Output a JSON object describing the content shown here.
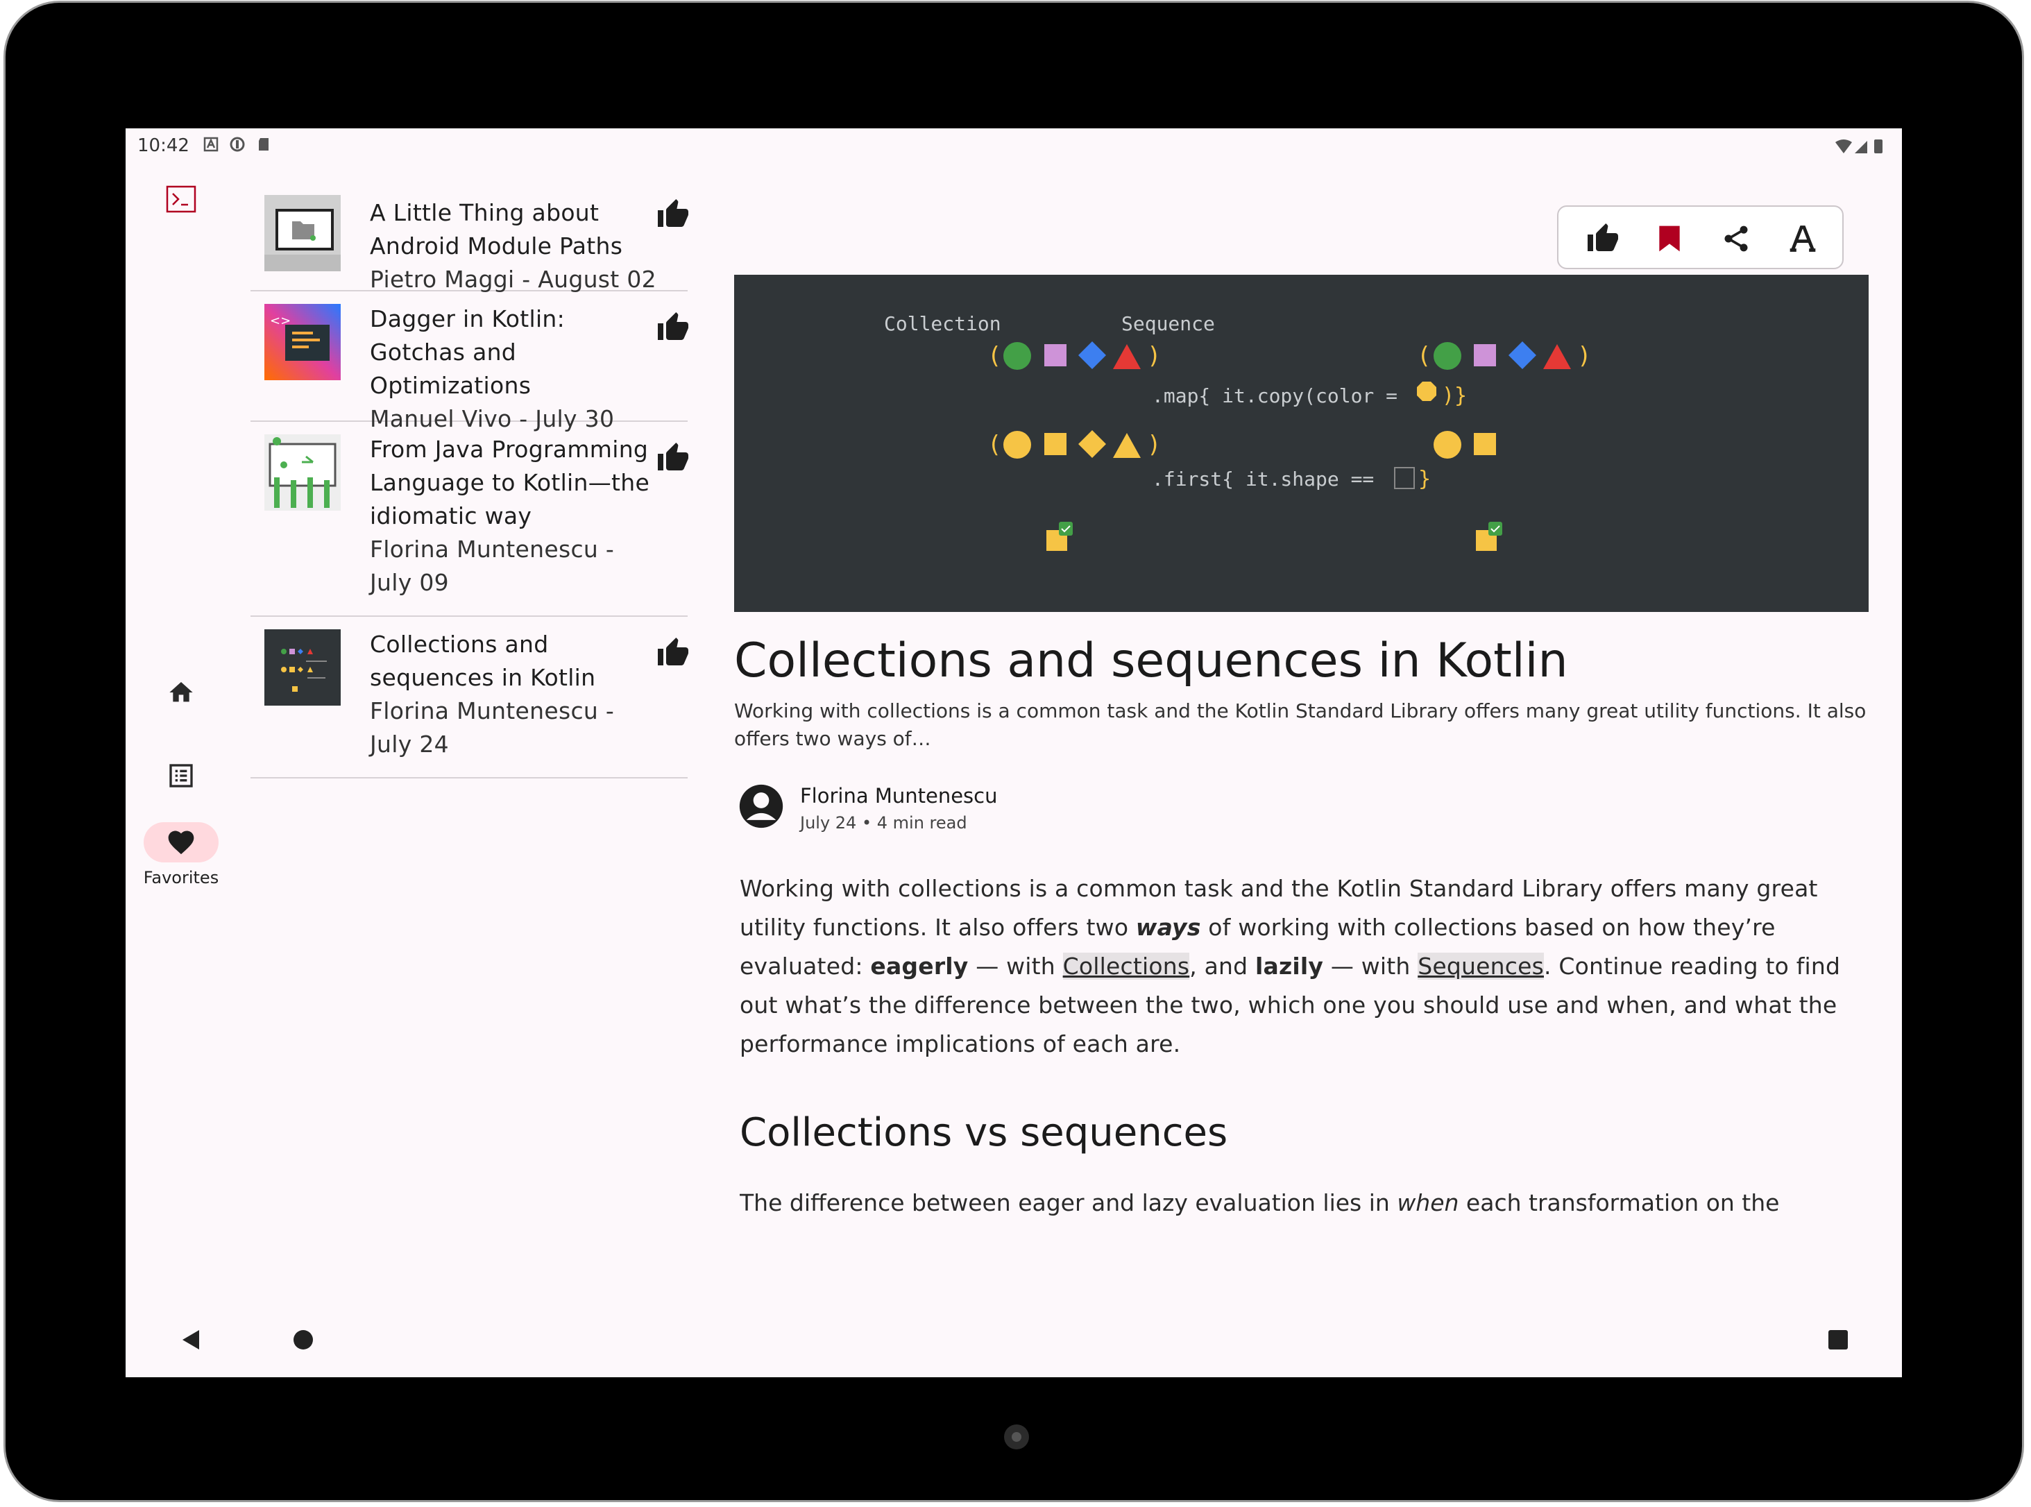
{
  "status_bar": {
    "time": "10:42"
  },
  "nav_rail": {
    "items": [
      {
        "name": "home"
      },
      {
        "name": "list"
      },
      {
        "name": "favorites",
        "label": "Favorites"
      }
    ]
  },
  "articles": [
    {
      "title": "A Little Thing about Android Module Paths",
      "meta": "Pietro Maggi - August 02"
    },
    {
      "title": "Dagger in Kotlin: Gotchas and Optimizations",
      "meta": "Manuel Vivo - July 30"
    },
    {
      "title": "From Java Programming Language to Kotlin—the idiomatic way",
      "meta": "Florina Muntenescu - July 09"
    },
    {
      "title": "Collections and sequences in Kotlin",
      "meta": "Florina Muntenescu - July 24"
    }
  ],
  "hero": {
    "label_left": "Collection",
    "label_right": "Sequence",
    "map_code": ".map{ it.copy(color = ",
    "first_code": ".first{ it.shape == "
  },
  "article": {
    "title": "Collections and sequences in Kotlin",
    "summary": "Working with collections is a common task and the Kotlin Standard Library offers many great utility functions. It also offers two ways of…",
    "author": "Florina Muntenescu",
    "author_meta": "July 24 • 4 min read",
    "p1_a": "Working with collections is a common task and the Kotlin Standard Library offers many great utility functions. It also offers two ",
    "p1_ways": "ways",
    "p1_b": " of working with collections based on how they’re evaluated: ",
    "p1_eagerly": "eagerly",
    "p1_c": " — with ",
    "p1_link1": "Collections",
    "p1_d": ", and ",
    "p1_lazily": "lazily",
    "p1_e": " — with ",
    "p1_link2": "Sequences",
    "p1_f": ". Continue reading to find out what’s the difference between the two, which one you should use and when, and what the performance implications of each are.",
    "h2": "Collections vs sequences",
    "p2_a": "The difference between eager and lazy evaluation lies in ",
    "p2_when": "when",
    "p2_b": " each transformation on the"
  },
  "colors": {
    "accent": "#b00020",
    "favorite_bg": "#ffd9de",
    "hero_bg": "#303538"
  }
}
